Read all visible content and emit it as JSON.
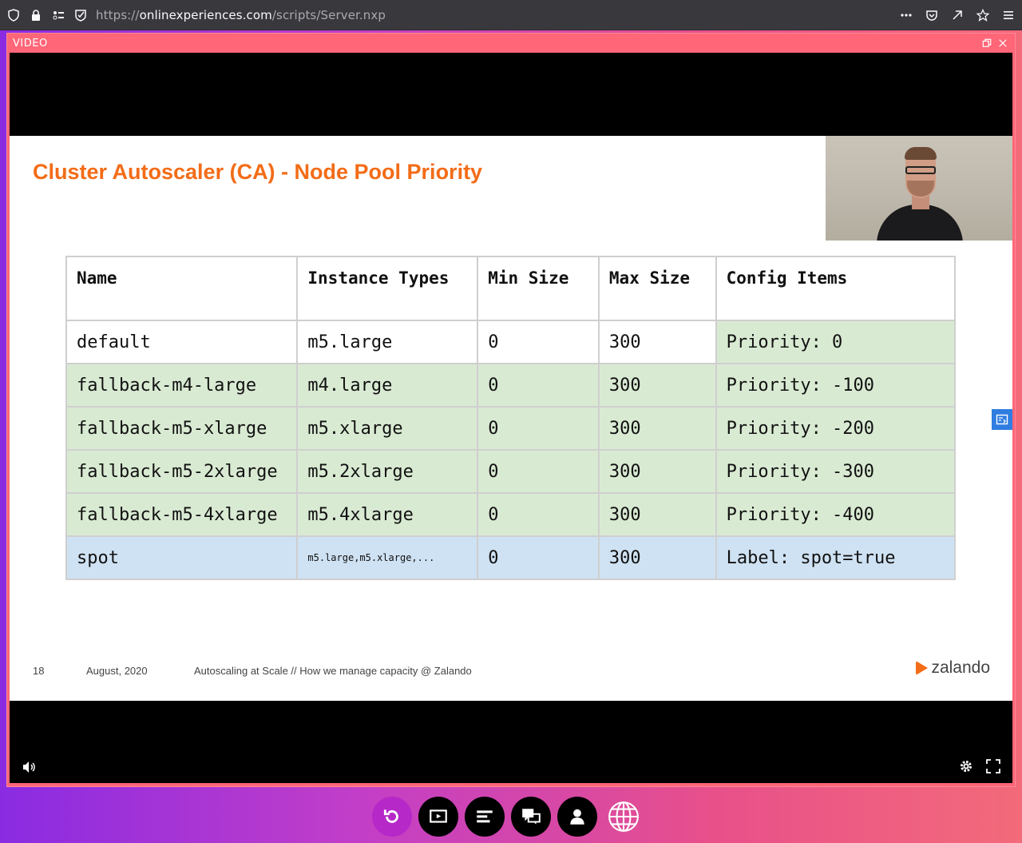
{
  "browser": {
    "url_scheme": "https://",
    "url_host": "onlinexperiences.com",
    "url_path": "/scripts/Server.nxp"
  },
  "video_window": {
    "title": "VIDEO"
  },
  "slide": {
    "title": "Cluster Autoscaler (CA) - Node Pool Priority",
    "table": {
      "headers": [
        "Name",
        "Instance Types",
        "Min Size",
        "Max Size",
        "Config Items"
      ],
      "rows": [
        {
          "name": "default",
          "types": "m5.large",
          "min": "0",
          "max": "300",
          "config": "Priority: 0"
        },
        {
          "name": "fallback-m4-large",
          "types": "m4.large",
          "min": "0",
          "max": "300",
          "config": "Priority: -100"
        },
        {
          "name": "fallback-m5-xlarge",
          "types": "m5.xlarge",
          "min": "0",
          "max": "300",
          "config": "Priority: -200"
        },
        {
          "name": "fallback-m5-2xlarge",
          "types": "m5.2xlarge",
          "min": "0",
          "max": "300",
          "config": "Priority: -300"
        },
        {
          "name": "fallback-m5-4xlarge",
          "types": "m5.4xlarge",
          "min": "0",
          "max": "300",
          "config": "Priority: -400"
        },
        {
          "name": "spot",
          "types": "m5.large,m5.xlarge,...",
          "min": "0",
          "max": "300",
          "config": "Label: spot=true"
        }
      ]
    },
    "footer": {
      "page": "18",
      "date": "August, 2020",
      "subtitle": "Autoscaling at Scale // How we manage capacity @ Zalando"
    },
    "logo": "zalando"
  },
  "colors": {
    "title_orange": "#f36c17",
    "row_green": "#d9ead3",
    "row_blue": "#cfe2f3",
    "window_border": "#ff6678"
  },
  "dock": {
    "icons": [
      "refresh-icon",
      "slides-icon",
      "agenda-icon",
      "chat-icon",
      "profile-icon",
      "language-icon"
    ]
  }
}
